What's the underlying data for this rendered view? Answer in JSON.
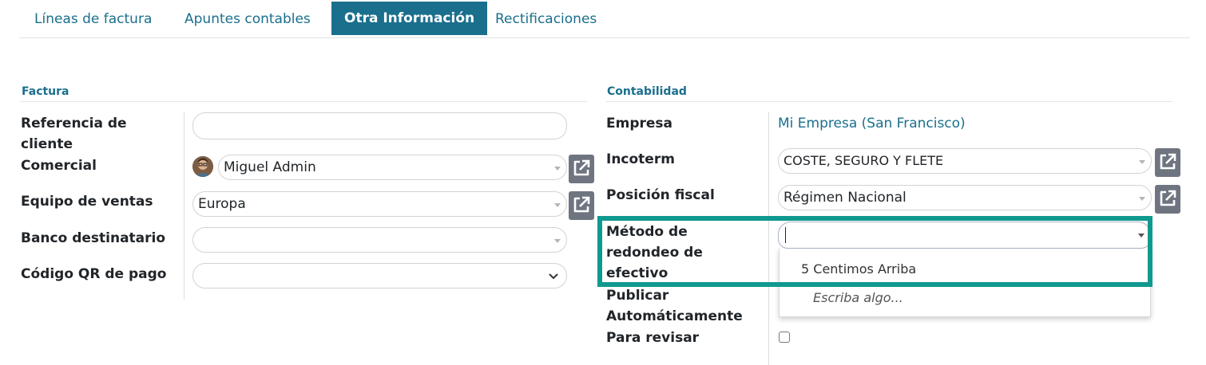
{
  "tabs": [
    {
      "label": "Líneas de factura",
      "active": false
    },
    {
      "label": "Apuntes contables",
      "active": false
    },
    {
      "label": "Otra Información",
      "active": true
    },
    {
      "label": "Rectificaciones",
      "active": false
    }
  ],
  "factura": {
    "title": "Factura",
    "fields": {
      "referencia_cliente": {
        "label": "Referencia de cliente",
        "value": ""
      },
      "comercial": {
        "label": "Comercial",
        "value": "Miguel Admin"
      },
      "equipo_ventas": {
        "label": "Equipo de ventas",
        "value": "Europa"
      },
      "banco_destinatario": {
        "label": "Banco destinatario",
        "value": ""
      },
      "codigo_qr": {
        "label": "Código QR de pago",
        "value": ""
      }
    }
  },
  "contabilidad": {
    "title": "Contabilidad",
    "fields": {
      "empresa": {
        "label": "Empresa",
        "value": "Mi Empresa (San Francisco)"
      },
      "incoterm": {
        "label": "Incoterm",
        "value": "COSTE, SEGURO Y FLETE"
      },
      "posicion_fiscal": {
        "label": "Posición fiscal",
        "value": "Régimen Nacional"
      },
      "metodo_redondeo": {
        "label": "Método de redondeo de efectivo",
        "value": ""
      },
      "publicar_auto": {
        "label": "Publicar Automáticamente"
      },
      "para_revisar": {
        "label": "Para revisar",
        "checked": false
      }
    },
    "dropdown": {
      "options": [
        "5 Centimos Arriba"
      ],
      "hint": "Escriba algo..."
    }
  },
  "colors": {
    "accent": "#1a6f8d",
    "highlight": "#10998f",
    "button": "#6f7580"
  },
  "icons": {
    "external_link": "external-link-icon",
    "avatar": "user-avatar"
  }
}
